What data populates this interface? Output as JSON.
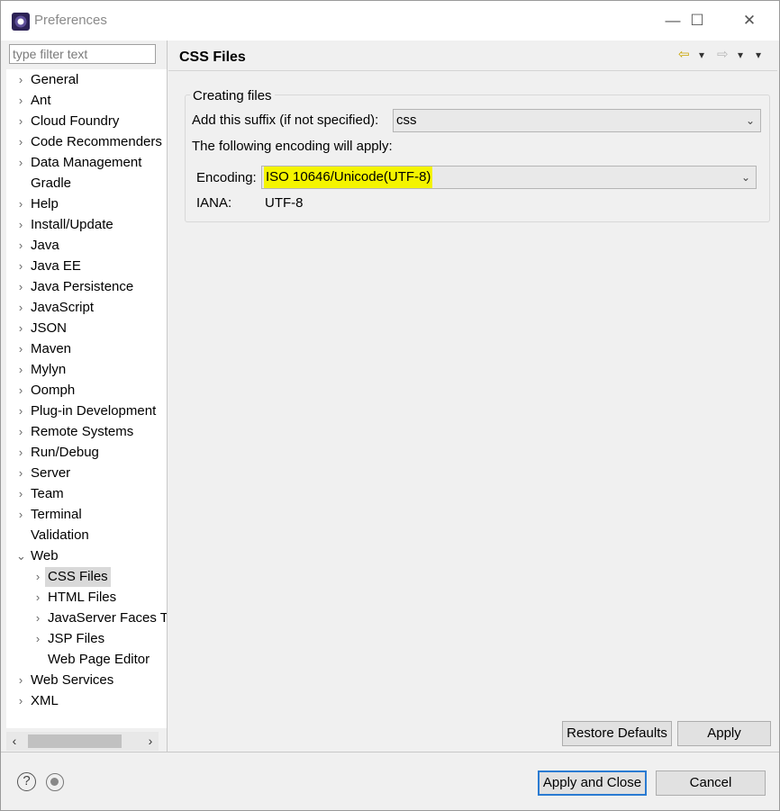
{
  "window": {
    "title": "Preferences",
    "minimize_glyph": "—",
    "maximize_glyph": "☐",
    "close_glyph": "✕"
  },
  "filter": {
    "placeholder": "type filter text"
  },
  "tree": {
    "collapsed_glyph": "›",
    "expanded_glyph": "⌄",
    "items": [
      {
        "label": "General",
        "expandable": true
      },
      {
        "label": "Ant",
        "expandable": true
      },
      {
        "label": "Cloud Foundry",
        "expandable": true
      },
      {
        "label": "Code Recommenders",
        "expandable": true
      },
      {
        "label": "Data Management",
        "expandable": true
      },
      {
        "label": "Gradle",
        "expandable": false
      },
      {
        "label": "Help",
        "expandable": true
      },
      {
        "label": "Install/Update",
        "expandable": true
      },
      {
        "label": "Java",
        "expandable": true
      },
      {
        "label": "Java EE",
        "expandable": true
      },
      {
        "label": "Java Persistence",
        "expandable": true
      },
      {
        "label": "JavaScript",
        "expandable": true
      },
      {
        "label": "JSON",
        "expandable": true
      },
      {
        "label": "Maven",
        "expandable": true
      },
      {
        "label": "Mylyn",
        "expandable": true
      },
      {
        "label": "Oomph",
        "expandable": true
      },
      {
        "label": "Plug-in Development",
        "expandable": true
      },
      {
        "label": "Remote Systems",
        "expandable": true
      },
      {
        "label": "Run/Debug",
        "expandable": true
      },
      {
        "label": "Server",
        "expandable": true
      },
      {
        "label": "Team",
        "expandable": true
      },
      {
        "label": "Terminal",
        "expandable": true
      },
      {
        "label": "Validation",
        "expandable": false
      },
      {
        "label": "Web",
        "expandable": true,
        "expanded": true
      },
      {
        "label": "CSS Files",
        "expandable": true,
        "child": true,
        "selected": true
      },
      {
        "label": "HTML Files",
        "expandable": true,
        "child": true
      },
      {
        "label": "JavaServer Faces Tools",
        "expandable": true,
        "child": true
      },
      {
        "label": "JSP Files",
        "expandable": true,
        "child": true
      },
      {
        "label": "Web Page Editor",
        "expandable": false,
        "child": true
      },
      {
        "label": "Web Services",
        "expandable": true
      },
      {
        "label": "XML",
        "expandable": true
      }
    ]
  },
  "scrollbar": {
    "left_glyph": "‹",
    "right_glyph": "›"
  },
  "page": {
    "title": "CSS Files",
    "nav": {
      "back_glyph": "⇦",
      "forward_glyph": "⇨",
      "dropdown_glyph": "▾",
      "menu_glyph": "▾"
    },
    "group_label": "Creating files",
    "suffix_label": "Add this suffix (if not specified):",
    "suffix_value": "css",
    "encoding_note": "The following encoding will apply:",
    "encoding_label": "Encoding:",
    "encoding_value": "ISO 10646/Unicode(UTF-8)",
    "iana_label": "IANA:",
    "iana_value": "UTF-8",
    "caret_glyph": "⌄"
  },
  "buttons": {
    "restore_defaults": "Restore Defaults",
    "apply": "Apply",
    "apply_and_close": "Apply and Close",
    "cancel": "Cancel"
  },
  "footer": {
    "help_glyph": "?"
  },
  "colors": {
    "highlight": "#f4f400",
    "default_button_border": "#2a7bd2"
  }
}
